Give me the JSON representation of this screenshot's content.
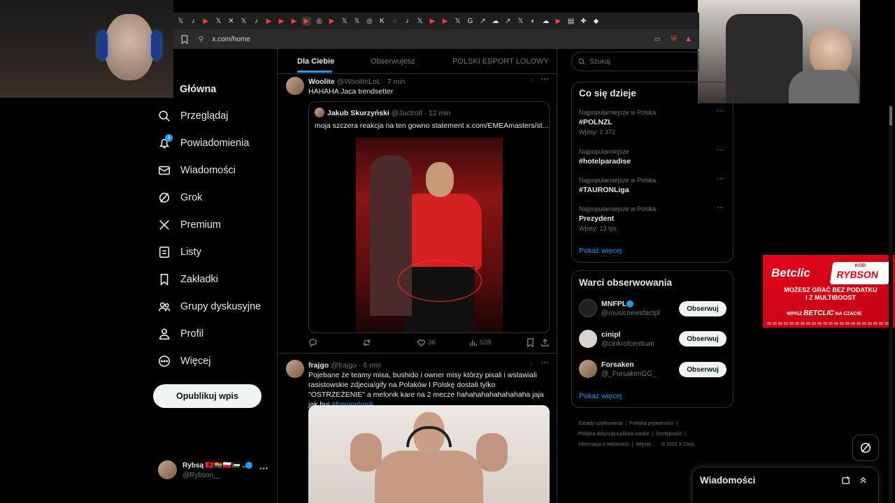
{
  "browser": {
    "url": "x.com/home",
    "tabs": [
      "𝕏",
      "♪",
      "▶",
      "𝕏",
      "✕",
      "𝕏",
      "♪",
      "▶",
      "▶",
      "▶",
      "▶",
      "◎",
      "▶",
      "𝕏",
      "𝕏",
      "◎",
      "K",
      "◌",
      "♪",
      "𝕏",
      "▶",
      "▶",
      "𝕏",
      "G",
      "↗",
      "☁",
      "↗",
      "𝕏",
      "◐",
      "☁",
      "▶",
      "▤",
      "✚",
      "◆"
    ]
  },
  "nav": {
    "home": "Główna",
    "explore": "Przeglądaj",
    "notifications": "Powiadomienia",
    "notif_count": "3",
    "messages": "Wiadomości",
    "grok": "Grok",
    "premium": "Premium",
    "lists": "Listy",
    "bookmarks": "Zakładki",
    "communities": "Grupy dyskusyjne",
    "profile": "Profil",
    "more": "Więcej",
    "post_button": "Opublikuj wpis",
    "account_name": "Rybsą 🇦🇱🏳️‍🌈🇵🇱🇵🇸 ...",
    "account_handle": "@Rybson__"
  },
  "feed": {
    "tabs": [
      "Dla Ciebie",
      "Obserwujesz",
      "POLSKI ESPORT LOLOWY"
    ],
    "tweet1": {
      "name": "Woolite",
      "handle": "@WooliteLoL",
      "time": "· 7 min",
      "text": "HAHAHA Jaca trendsetter",
      "quote_name": "Jakub Skurzyński",
      "quote_handle": "@Jactroll",
      "quote_time": "· 12 min",
      "quote_text": "moja szczera reakcja na ten gowno statement  x.com/EMEAmasters/st...",
      "likes": "36",
      "views": "528"
    },
    "tweet2": {
      "name": "frajgo",
      "handle": "@frajgo",
      "time": "· 6 min",
      "text": "Pojebane że teamy misa, bushido i owner misy którzy pisali i wstawiali rasistowskie zdjecia/gify na Polaków I Polskę dostali tylko \"OSTRZEŻENIE\" a melonik kare na 2 mecze hahahahahahahahaha jaja jak huj",
      "hashtag": "#freemelonik"
    }
  },
  "sidebar": {
    "search_placeholder": "Szukaj",
    "trends_title": "Co się dzieje",
    "trends": [
      {
        "meta": "Najpopularniejsze w Polska",
        "name": "#POLNZL",
        "posts": "Wpisy: 2 372"
      },
      {
        "meta": "Najpopularniejsze",
        "name": "#hotelparadise",
        "posts": ""
      },
      {
        "meta": "Najpopularniejsze w Polska",
        "name": "#TAURONLiga",
        "posts": ""
      },
      {
        "meta": "Najpopularniejsze w Polska",
        "name": "Prezydent",
        "posts": "Wpisy: 13 tys."
      }
    ],
    "show_more": "Pokaż więcej",
    "who_title": "Warci obserwowania",
    "who": [
      {
        "name": "MNFPL",
        "handle": "@musicnewsfactpl",
        "button": "Obserwuj"
      },
      {
        "name": "cinipl",
        "handle": "@cinkrofcentrum",
        "button": "Obserwuj"
      },
      {
        "name": "Forsaken",
        "handle": "@_ForsakenGG_",
        "button": "Obserwuj"
      }
    ],
    "footer": [
      "Zasady użytkowania",
      "Polityka prywatności",
      "Polityka dotycząca plików cookie",
      "Dostępność",
      "Informacja o reklamach",
      "Więcej ...",
      "© 2025 X Corp."
    ]
  },
  "messages_drawer": {
    "label": "Wiadomości"
  },
  "ad": {
    "brand": "Betclic",
    "kod": "KOD",
    "code": "RYBSON",
    "line1": "MOŻESZ GRAĆ BEZ PODATKU",
    "line2": "I Z MULTIBOOST",
    "wpisz": "WPISZ",
    "code2": "BETCLIC",
    "na_czacie": "NA CZACIE"
  },
  "colors": {
    "accent": "#1d9bf0",
    "ad_red": "#e3051b",
    "border": "#2f3336"
  }
}
